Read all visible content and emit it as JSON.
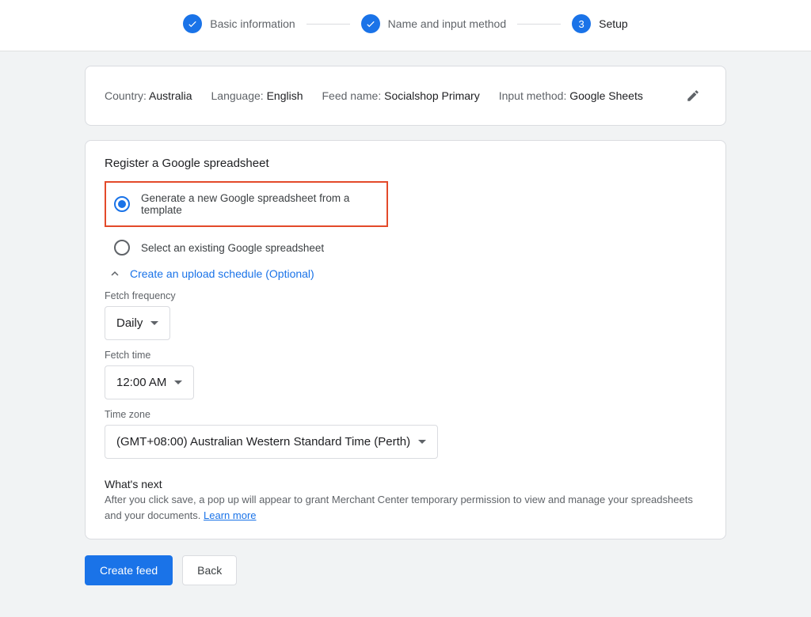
{
  "stepper": {
    "step1": "Basic information",
    "step2": "Name and input method",
    "step3_num": "3",
    "step3": "Setup"
  },
  "summary": {
    "country_label": "Country: ",
    "country_value": "Australia",
    "language_label": "Language: ",
    "language_value": "English",
    "feedname_label": "Feed name: ",
    "feedname_value": "Socialshop Primary",
    "method_label": "Input method: ",
    "method_value": "Google Sheets"
  },
  "section": {
    "title": "Register a Google spreadsheet",
    "radio1": "Generate a new Google spreadsheet from a template",
    "radio2": "Select an existing Google spreadsheet"
  },
  "schedule": {
    "toggle": "Create an upload schedule (Optional)",
    "freq_label": "Fetch frequency",
    "freq_value": "Daily",
    "time_label": "Fetch time",
    "time_value": "12:00 AM",
    "tz_label": "Time zone",
    "tz_value": "(GMT+08:00) Australian Western Standard Time (Perth)"
  },
  "whatsnext": {
    "title": "What's next",
    "body": "After you click save, a pop up will appear to grant Merchant Center temporary permission to view and manage your spreadsheets and your documents. ",
    "learn_more": "Learn more"
  },
  "actions": {
    "create": "Create feed",
    "back": "Back"
  }
}
